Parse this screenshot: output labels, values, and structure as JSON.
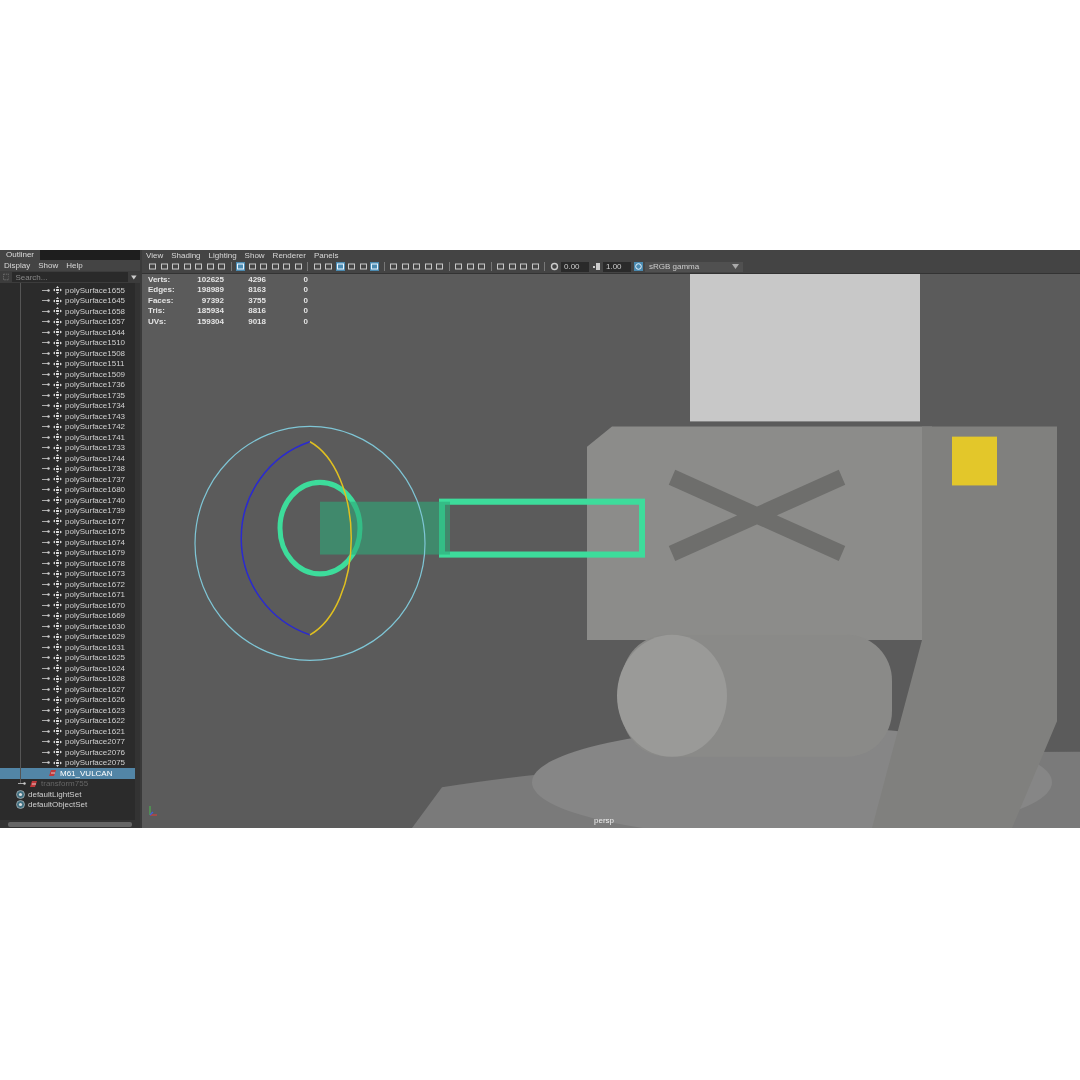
{
  "outliner": {
    "title": "Outliner",
    "menu": [
      "Display",
      "Show",
      "Help"
    ],
    "search": {
      "placeholder": "Search..."
    },
    "items": [
      {
        "kind": "mesh",
        "label": "polySurface1655",
        "selected": false,
        "dimmed": false
      },
      {
        "kind": "mesh",
        "label": "polySurface1645",
        "selected": false,
        "dimmed": false
      },
      {
        "kind": "mesh",
        "label": "polySurface1658",
        "selected": false,
        "dimmed": false
      },
      {
        "kind": "mesh",
        "label": "polySurface1657",
        "selected": false,
        "dimmed": false
      },
      {
        "kind": "mesh",
        "label": "polySurface1644",
        "selected": false,
        "dimmed": false
      },
      {
        "kind": "mesh",
        "label": "polySurface1510",
        "selected": false,
        "dimmed": false
      },
      {
        "kind": "mesh",
        "label": "polySurface1508",
        "selected": false,
        "dimmed": false
      },
      {
        "kind": "mesh",
        "label": "polySurface1511",
        "selected": false,
        "dimmed": false
      },
      {
        "kind": "mesh",
        "label": "polySurface1509",
        "selected": false,
        "dimmed": false
      },
      {
        "kind": "mesh",
        "label": "polySurface1736",
        "selected": false,
        "dimmed": false
      },
      {
        "kind": "mesh",
        "label": "polySurface1735",
        "selected": false,
        "dimmed": false
      },
      {
        "kind": "mesh",
        "label": "polySurface1734",
        "selected": false,
        "dimmed": false
      },
      {
        "kind": "mesh",
        "label": "polySurface1743",
        "selected": false,
        "dimmed": false
      },
      {
        "kind": "mesh",
        "label": "polySurface1742",
        "selected": false,
        "dimmed": false
      },
      {
        "kind": "mesh",
        "label": "polySurface1741",
        "selected": false,
        "dimmed": false
      },
      {
        "kind": "mesh",
        "label": "polySurface1733",
        "selected": false,
        "dimmed": false
      },
      {
        "kind": "mesh",
        "label": "polySurface1744",
        "selected": false,
        "dimmed": false
      },
      {
        "kind": "mesh",
        "label": "polySurface1738",
        "selected": false,
        "dimmed": false
      },
      {
        "kind": "mesh",
        "label": "polySurface1737",
        "selected": false,
        "dimmed": false
      },
      {
        "kind": "mesh",
        "label": "polySurface1680",
        "selected": false,
        "dimmed": false
      },
      {
        "kind": "mesh",
        "label": "polySurface1740",
        "selected": false,
        "dimmed": false
      },
      {
        "kind": "mesh",
        "label": "polySurface1739",
        "selected": false,
        "dimmed": false
      },
      {
        "kind": "mesh",
        "label": "polySurface1677",
        "selected": false,
        "dimmed": false
      },
      {
        "kind": "mesh",
        "label": "polySurface1675",
        "selected": false,
        "dimmed": false
      },
      {
        "kind": "mesh",
        "label": "polySurface1674",
        "selected": false,
        "dimmed": false
      },
      {
        "kind": "mesh",
        "label": "polySurface1679",
        "selected": false,
        "dimmed": false
      },
      {
        "kind": "mesh",
        "label": "polySurface1678",
        "selected": false,
        "dimmed": false
      },
      {
        "kind": "mesh",
        "label": "polySurface1673",
        "selected": false,
        "dimmed": false
      },
      {
        "kind": "mesh",
        "label": "polySurface1672",
        "selected": false,
        "dimmed": false
      },
      {
        "kind": "mesh",
        "label": "polySurface1671",
        "selected": false,
        "dimmed": false
      },
      {
        "kind": "mesh",
        "label": "polySurface1670",
        "selected": false,
        "dimmed": false
      },
      {
        "kind": "mesh",
        "label": "polySurface1669",
        "selected": false,
        "dimmed": false
      },
      {
        "kind": "mesh",
        "label": "polySurface1630",
        "selected": false,
        "dimmed": false
      },
      {
        "kind": "mesh",
        "label": "polySurface1629",
        "selected": false,
        "dimmed": false
      },
      {
        "kind": "mesh",
        "label": "polySurface1631",
        "selected": false,
        "dimmed": false
      },
      {
        "kind": "mesh",
        "label": "polySurface1625",
        "selected": false,
        "dimmed": false
      },
      {
        "kind": "mesh",
        "label": "polySurface1624",
        "selected": false,
        "dimmed": false
      },
      {
        "kind": "mesh",
        "label": "polySurface1628",
        "selected": false,
        "dimmed": false
      },
      {
        "kind": "mesh",
        "label": "polySurface1627",
        "selected": false,
        "dimmed": false
      },
      {
        "kind": "mesh",
        "label": "polySurface1626",
        "selected": false,
        "dimmed": false
      },
      {
        "kind": "mesh",
        "label": "polySurface1623",
        "selected": false,
        "dimmed": false
      },
      {
        "kind": "mesh",
        "label": "polySurface1622",
        "selected": false,
        "dimmed": false
      },
      {
        "kind": "mesh",
        "label": "polySurface1621",
        "selected": false,
        "dimmed": false
      },
      {
        "kind": "mesh",
        "label": "polySurface2077",
        "selected": false,
        "dimmed": false
      },
      {
        "kind": "mesh",
        "label": "polySurface2076",
        "selected": false,
        "dimmed": false
      },
      {
        "kind": "mesh",
        "label": "polySurface2075",
        "selected": false,
        "dimmed": false
      },
      {
        "kind": "transform",
        "label": "M61_VULCAN",
        "selected": true,
        "dimmed": false
      },
      {
        "kind": "transform-top",
        "label": "transform755",
        "selected": false,
        "dimmed": true
      },
      {
        "kind": "set",
        "label": "defaultLightSet",
        "selected": false,
        "dimmed": false
      },
      {
        "kind": "set",
        "label": "defaultObjectSet",
        "selected": false,
        "dimmed": false
      }
    ]
  },
  "viewport": {
    "menu": [
      "View",
      "Shading",
      "Lighting",
      "Show",
      "Renderer",
      "Panels"
    ],
    "toolbar": [
      {
        "selected": false
      },
      {
        "selected": false
      },
      {
        "selected": false
      },
      {
        "selected": false
      },
      {
        "selected": false
      },
      {
        "selected": false
      },
      {
        "selected": false
      },
      {
        "selected": true
      },
      {
        "selected": false
      },
      {
        "selected": false
      },
      {
        "selected": false
      },
      {
        "selected": false
      },
      {
        "selected": false
      },
      {
        "selected": false
      },
      {
        "selected": false
      },
      {
        "selected": true
      },
      {
        "selected": false
      },
      {
        "selected": false
      },
      {
        "selected": true
      },
      {
        "selected": false
      },
      {
        "selected": false
      },
      {
        "selected": false
      },
      {
        "selected": false
      },
      {
        "selected": false
      },
      {
        "selected": false
      },
      {
        "selected": false
      },
      {
        "selected": false
      },
      {
        "selected": false
      },
      {
        "selected": false
      },
      {
        "selected": false
      },
      {
        "selected": false
      }
    ],
    "exposure": "0.00",
    "gamma": "1.00",
    "color_space": "sRGB gamma",
    "stats": [
      [
        "Verts:",
        "102625",
        "4296",
        "0"
      ],
      [
        "Edges:",
        "198989",
        "8163",
        "0"
      ],
      [
        "Faces:",
        "97392",
        "3755",
        "0"
      ],
      [
        "Tris:",
        "185934",
        "8816",
        "0"
      ],
      [
        "UVs:",
        "159304",
        "9018",
        "0"
      ]
    ],
    "camera": "persp"
  }
}
